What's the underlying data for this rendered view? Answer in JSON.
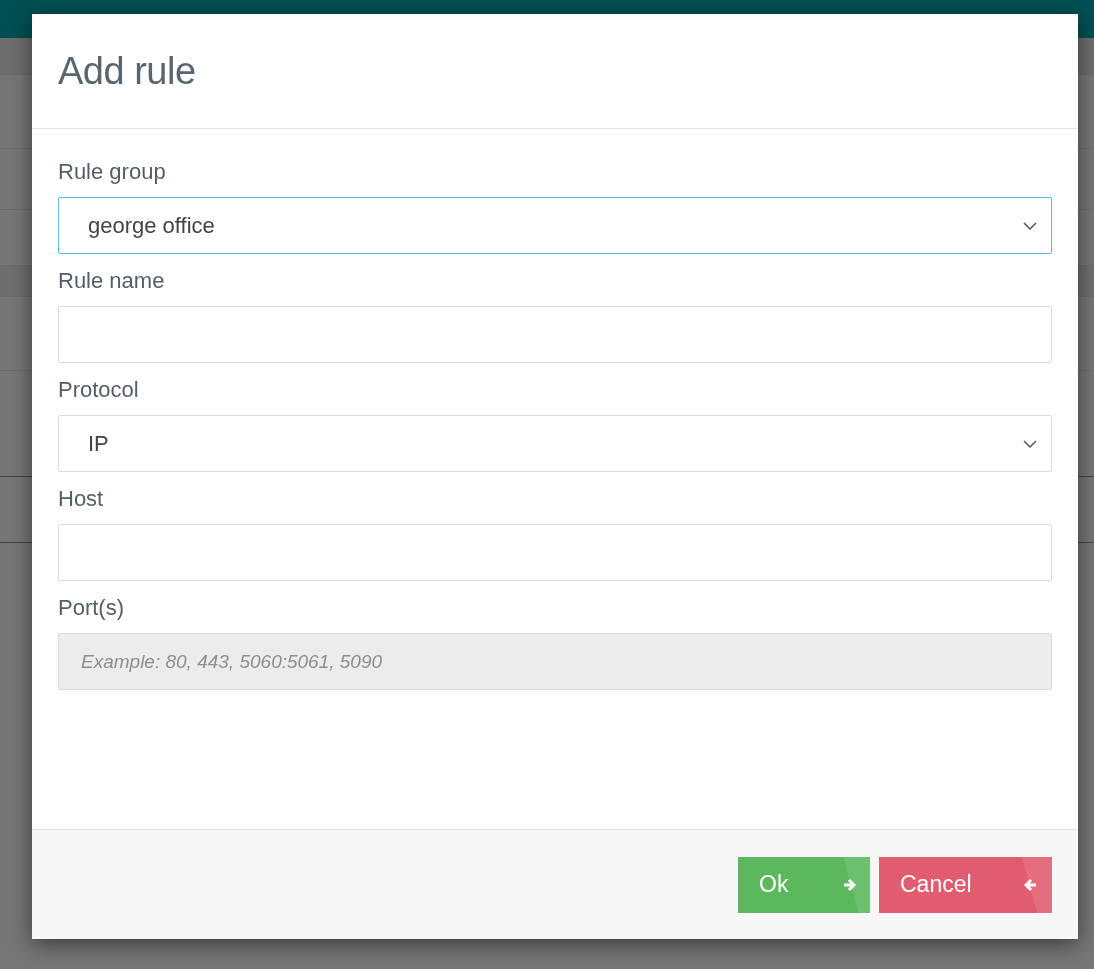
{
  "dialog": {
    "title": "Add rule",
    "fields": [
      {
        "label": "Rule group",
        "kind": "select",
        "value": "george office",
        "focused": true,
        "disabled": false
      },
      {
        "label": "Rule name",
        "kind": "text",
        "focused": false,
        "disabled": false
      },
      {
        "label": "Protocol",
        "kind": "select",
        "value": "IP",
        "focused": false,
        "disabled": false
      },
      {
        "label": "Host",
        "kind": "text",
        "focused": false,
        "disabled": false
      },
      {
        "label": "Port(s)",
        "kind": "text",
        "placeholder": "Example: 80, 443, 5060:5061, 5090",
        "focused": false,
        "disabled": true
      }
    ],
    "buttons": [
      {
        "label": "Ok",
        "kind": "confirm"
      },
      {
        "label": "Cancel",
        "kind": "cancel"
      }
    ]
  }
}
